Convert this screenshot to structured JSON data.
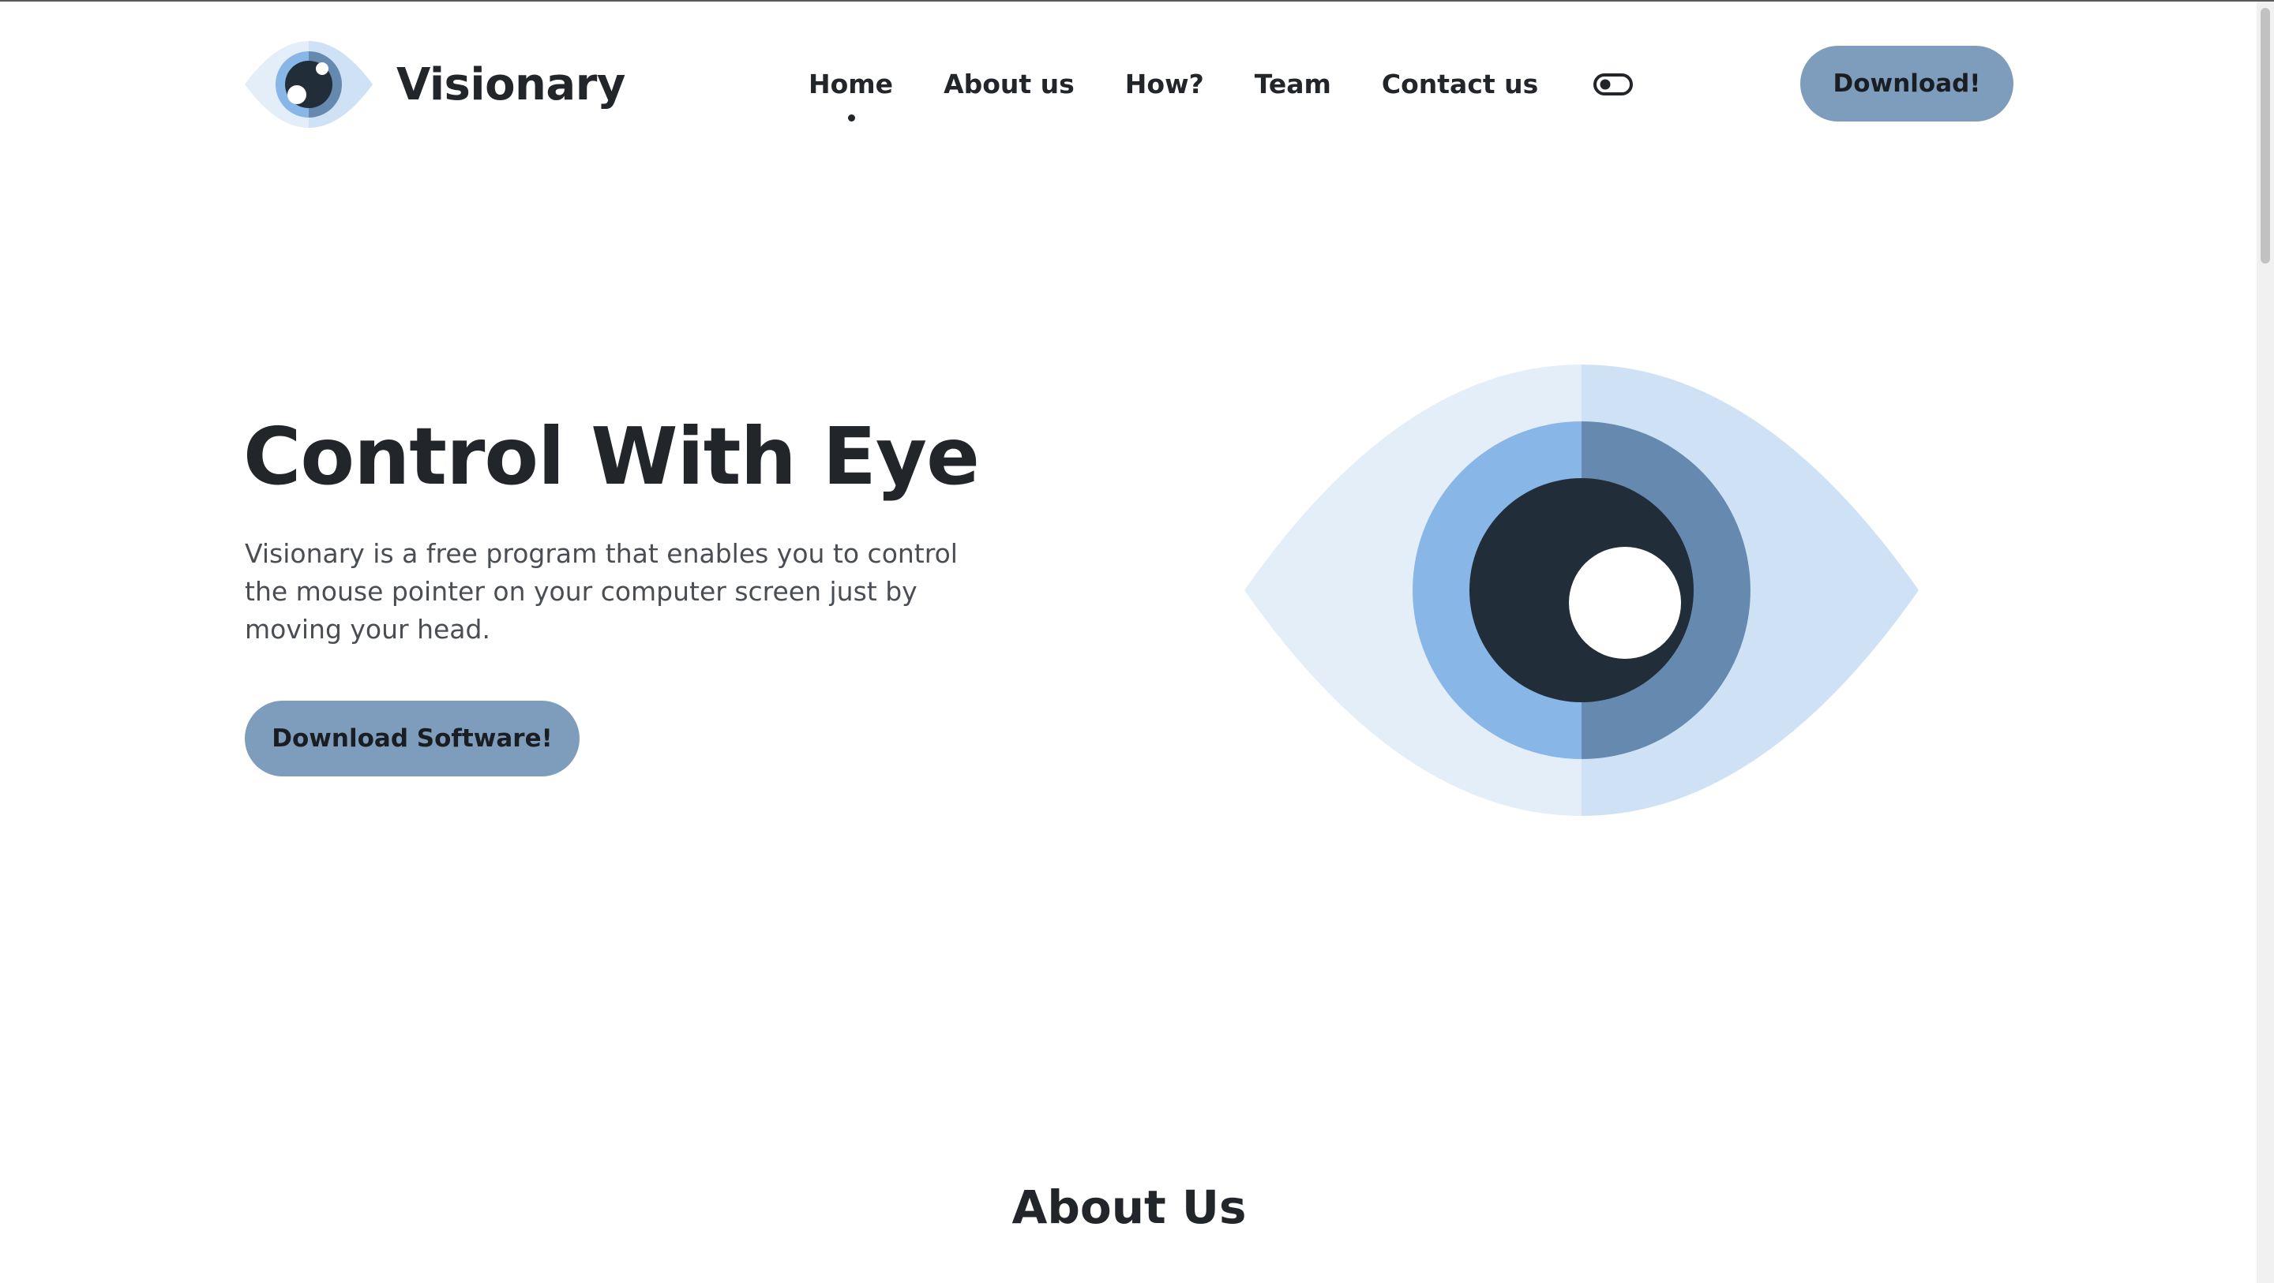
{
  "brand": {
    "name": "Visionary",
    "logo_icon": "eye-logo-icon"
  },
  "nav": {
    "items": [
      {
        "label": "Home",
        "active": true
      },
      {
        "label": "About us",
        "active": false
      },
      {
        "label": "How?",
        "active": false
      },
      {
        "label": "Team",
        "active": false
      },
      {
        "label": "Contact us",
        "active": false
      }
    ],
    "theme_toggle_icon": "toggle-switch-icon",
    "download_label": "Download!"
  },
  "hero": {
    "title": "Control With Eye",
    "description": "Visionary is a free program that enables you to control the mouse pointer on your computer screen just by moving your head.",
    "button_label": "Download Software!",
    "illustration_icon": "eye-illustration-icon"
  },
  "about": {
    "title": "About Us"
  },
  "colors": {
    "accent": "#7e9dbd",
    "text": "#22262b",
    "muted_text": "#4a4e54",
    "eye_outer_light": "#e4eef8",
    "eye_outer": "#cfe2f5",
    "iris_light": "#88b6e6",
    "iris_dark": "#6689b0",
    "pupil": "#222d3a"
  }
}
